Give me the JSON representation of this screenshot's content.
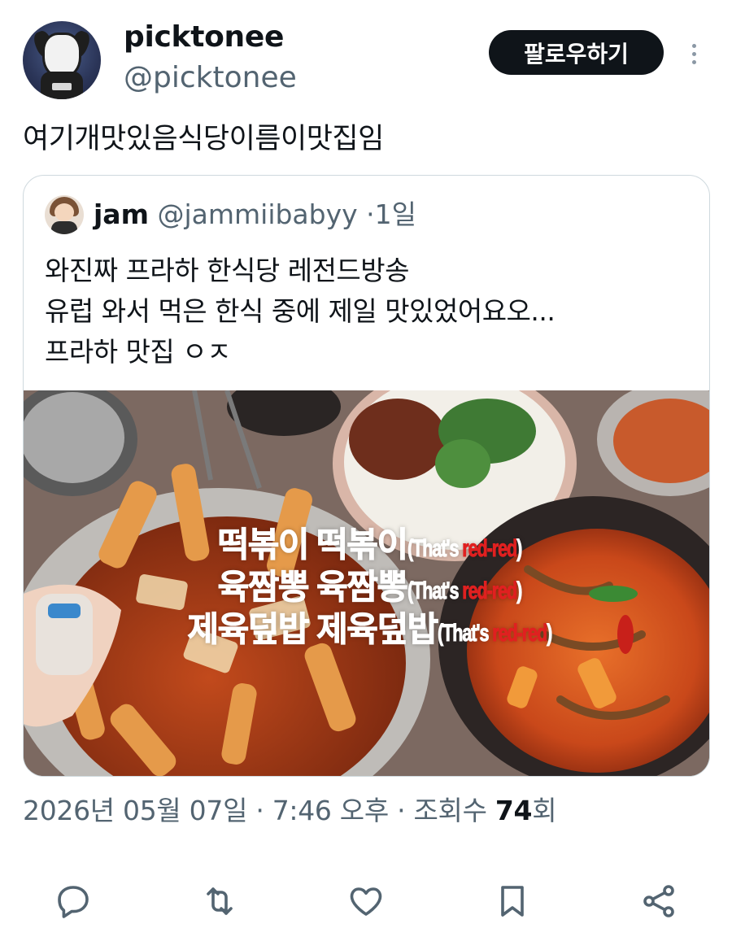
{
  "author": {
    "display_name": "picktonee",
    "handle": "@picktonee",
    "avatar_icon": "dog-character-avatar"
  },
  "follow_label": "팔로우하기",
  "tweet_text": "여기개맛있음식당이름이맛집임",
  "quoted": {
    "display_name": "jam",
    "handle": "@jammiibabyy",
    "separator": "·",
    "time": "1일",
    "lines": [
      "와진짜 프라하 한식당 레전드방송",
      "유럽 와서 먹은 한식 중에 제일 맛있었어요오...",
      "프라하 맛집 ㅇㅈ"
    ],
    "image": {
      "description_icon": "korean-food-photo",
      "captions": [
        {
          "korean": "떡볶이 떡볶이",
          "english_pre": "(That's ",
          "english_red": "red-red",
          "english_post": ")"
        },
        {
          "korean": "육짬뽕 육짬뽕",
          "english_pre": "(That's ",
          "english_red": "red-red",
          "english_post": ")"
        },
        {
          "korean": "제육덮밥 제육덮밥",
          "english_pre": "(That's ",
          "english_red": "red-red",
          "english_post": ")"
        }
      ]
    }
  },
  "meta": {
    "date": "2026년 05월 07일",
    "sep1": " · ",
    "time": "7:46 오후",
    "sep2": " · ",
    "views_label": "조회수 ",
    "views_count": "74",
    "views_suffix": "회"
  },
  "actions": [
    "reply-icon",
    "retweet-icon",
    "like-icon",
    "bookmark-icon",
    "share-icon"
  ],
  "colors": {
    "text": "#0f1419",
    "secondary": "#536471",
    "border": "#cfd9de",
    "button_bg": "#0f1419",
    "caption_red": "#e02020"
  }
}
